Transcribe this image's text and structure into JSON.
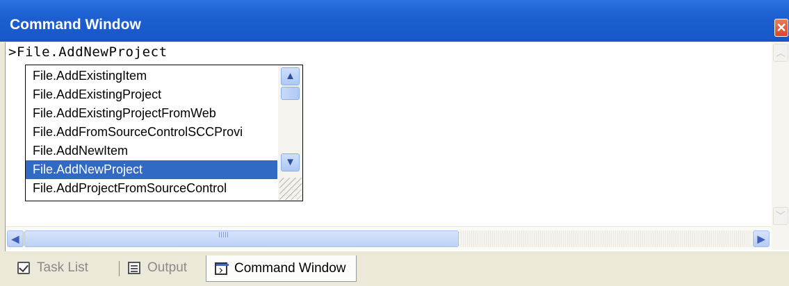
{
  "window": {
    "title": "Command Window",
    "close_glyph": "✕"
  },
  "command": {
    "input": ">File.AddNewProject"
  },
  "completion": {
    "items": [
      "File.AddExistingItem",
      "File.AddExistingProject",
      "File.AddExistingProjectFromWeb",
      "File.AddFromSourceControlSCCProvi",
      "File.AddNewItem",
      "File.AddNewProject",
      "File.AddProjectFromSourceControl"
    ],
    "selected_index": 5,
    "up_glyph": "▲",
    "down_glyph": "▼"
  },
  "hscroll": {
    "left_glyph": "◀",
    "right_glyph": "▶"
  },
  "vscroll": {
    "up_glyph": "︿",
    "down_glyph": "﹀"
  },
  "tabs": [
    {
      "label": "Task List",
      "icon": "tasklist-icon",
      "active": false
    },
    {
      "label": "Output",
      "icon": "output-icon",
      "active": false
    },
    {
      "label": "Command Window",
      "icon": "command-window-icon",
      "active": true
    }
  ],
  "colors": {
    "titlebar": "#1d5fd0",
    "selection": "#316ac5",
    "chrome": "#ece9d8"
  }
}
